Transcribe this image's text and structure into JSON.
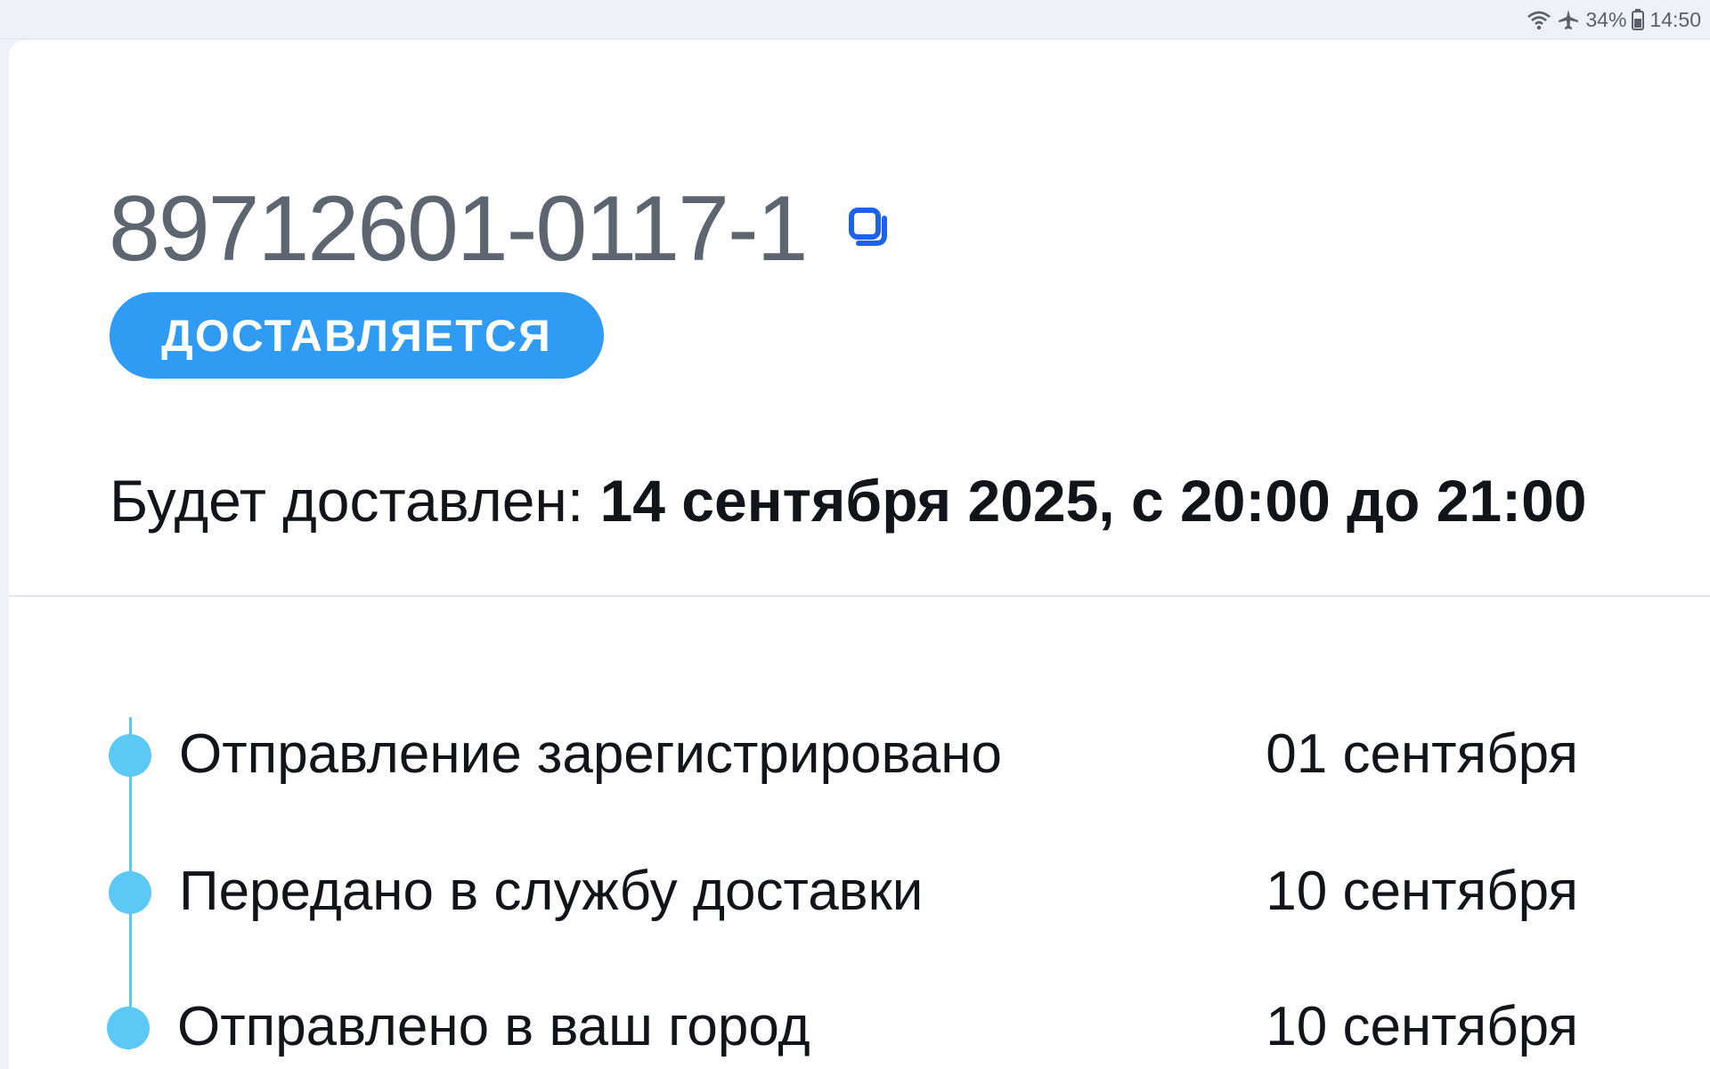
{
  "status_bar": {
    "battery": "34%",
    "time": "14:50",
    "icons": [
      "wifi-icon",
      "airplane-icon",
      "battery-icon"
    ]
  },
  "order": {
    "number": "89712601-0117-1",
    "copy_icon": "copy-icon",
    "status": "ДОСТАВЛЯЕТСЯ",
    "status_color": "#2f9bf3",
    "delivery_label": "Будет доставлен: ",
    "delivery_value": "14 сентября 2025, с 20:00 до 21:00"
  },
  "timeline": {
    "accent": "#5bc8f5",
    "events": [
      {
        "label": "Отправление зарегистрировано",
        "date": "01 сентября"
      },
      {
        "label": "Передано в службу доставки",
        "date": "10 сентября"
      },
      {
        "label": "Отправлено в ваш город",
        "date": "10 сентября"
      }
    ]
  }
}
